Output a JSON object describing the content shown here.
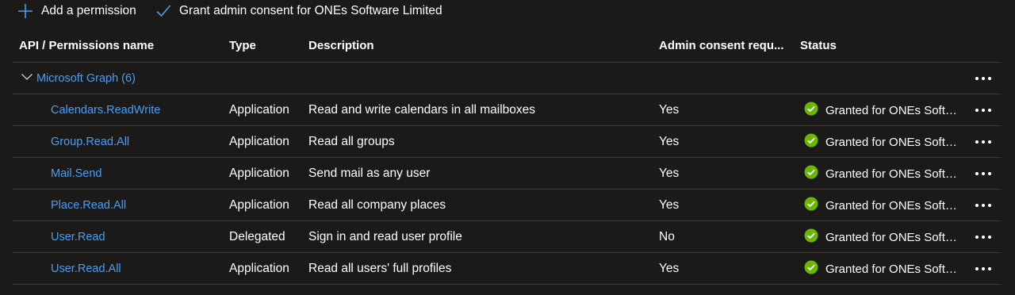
{
  "toolbar": {
    "add_label": "Add a permission",
    "grant_label": "Grant admin consent for ONEs Software Limited",
    "accent": "#479ef5"
  },
  "table": {
    "headers": {
      "name": "API / Permissions name",
      "type": "Type",
      "description": "Description",
      "admin_consent": "Admin consent requ...",
      "status": "Status"
    },
    "group": {
      "label": "Microsoft Graph (6)",
      "expanded": true
    },
    "rows": [
      {
        "name": "Calendars.ReadWrite",
        "type": "Application",
        "description": "Read and write calendars in all mailboxes",
        "admin_consent": "Yes",
        "status": "Granted for ONEs Software Limited"
      },
      {
        "name": "Group.Read.All",
        "type": "Application",
        "description": "Read all groups",
        "admin_consent": "Yes",
        "status": "Granted for ONEs Software Limited"
      },
      {
        "name": "Mail.Send",
        "type": "Application",
        "description": "Send mail as any user",
        "admin_consent": "Yes",
        "status": "Granted for ONEs Software Limited"
      },
      {
        "name": "Place.Read.All",
        "type": "Application",
        "description": "Read all company places",
        "admin_consent": "Yes",
        "status": "Granted for ONEs Software Limited"
      },
      {
        "name": "User.Read",
        "type": "Delegated",
        "description": "Sign in and read user profile",
        "admin_consent": "No",
        "status": "Granted for ONEs Software Limited"
      },
      {
        "name": "User.Read.All",
        "type": "Application",
        "description": "Read all users' full profiles",
        "admin_consent": "Yes",
        "status": "Granted for ONEs Software Limited"
      }
    ],
    "status_color": "#6bb700",
    "link_color": "#479ef5",
    "icons": {
      "add": "plus-icon",
      "grant": "checkmark-icon",
      "expand": "chevron-down-icon",
      "status": "check-circle-icon",
      "more": "more-dots-icon"
    }
  }
}
